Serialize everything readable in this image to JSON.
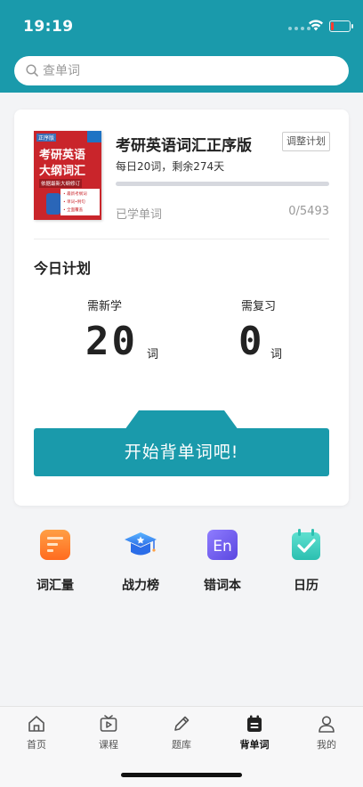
{
  "status": {
    "time": "19:19"
  },
  "search": {
    "placeholder": "查单词"
  },
  "plan": {
    "book_title": "考研英语词汇正序版",
    "adjust_label": "调整计划",
    "daily_text": "每日20词，剩余274天",
    "progress_fraction": 0,
    "learned_label": "已学单词",
    "learned_count": "0/5493",
    "cover": {
      "tag": "正序版",
      "line1": "考研英语",
      "line2": "大纲词汇",
      "subtitle": "依据最新大纲修订",
      "bullets": [
        "• 最新考纲词",
        "• 单词•例句",
        "• 全面覆盖"
      ]
    }
  },
  "today": {
    "title": "今日计划",
    "new_label": "需新学",
    "new_count": "20",
    "new_unit": "词",
    "review_label": "需复习",
    "review_count": "0",
    "review_unit": "词",
    "start_label": "开始背单词吧!"
  },
  "shortcuts": [
    {
      "label": "词汇量",
      "icon": "vocabulary-icon"
    },
    {
      "label": "战力榜",
      "icon": "graduation-cap-icon"
    },
    {
      "label": "错词本",
      "icon": "en-book-icon"
    },
    {
      "label": "日历",
      "icon": "calendar-check-icon"
    }
  ],
  "tabs": [
    {
      "label": "首页",
      "icon": "home-icon"
    },
    {
      "label": "课程",
      "icon": "play-tv-icon"
    },
    {
      "label": "题库",
      "icon": "pencil-icon"
    },
    {
      "label": "背单词",
      "icon": "word-calendar-icon",
      "active": true
    },
    {
      "label": "我的",
      "icon": "profile-icon"
    }
  ],
  "colors": {
    "accent": "#1a9aab",
    "book_red": "#c9252b"
  }
}
